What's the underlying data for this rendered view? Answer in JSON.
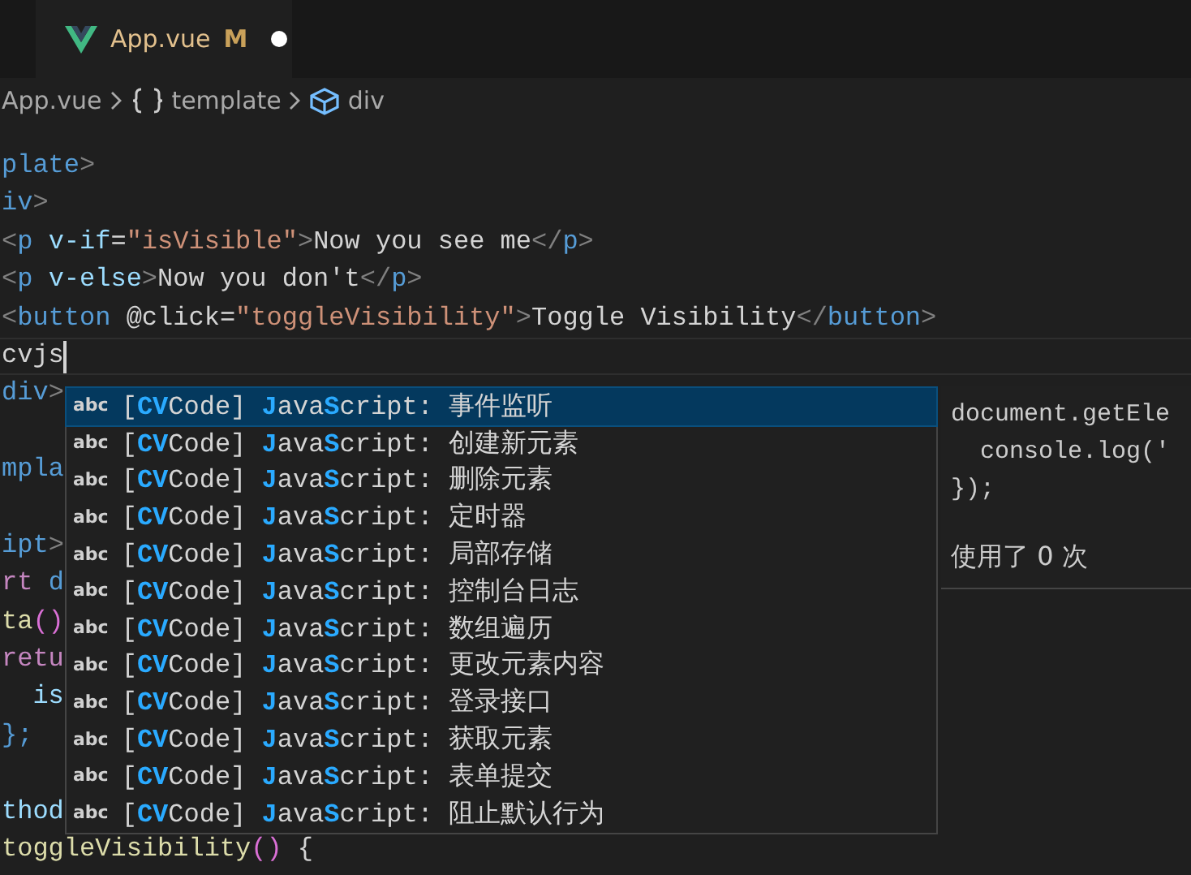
{
  "tab": {
    "title": "App.vue",
    "status": "M",
    "modified": true
  },
  "breadcrumb": [
    {
      "kind": "file",
      "label": "App.vue"
    },
    {
      "kind": "braces",
      "label": "template"
    },
    {
      "kind": "element",
      "label": "div"
    }
  ],
  "code": [
    {
      "current": false,
      "tokens": [
        {
          "text": "plate",
          "kind": "tag"
        },
        {
          "text": ">",
          "kind": "punct"
        }
      ]
    },
    {
      "current": false,
      "tokens": [
        {
          "text": "iv",
          "kind": "tag"
        },
        {
          "text": ">",
          "kind": "punct"
        }
      ]
    },
    {
      "current": false,
      "tokens": [
        {
          "text": "<",
          "kind": "punct"
        },
        {
          "text": "p ",
          "kind": "tag"
        },
        {
          "text": "v-if",
          "kind": "attr"
        },
        {
          "text": "=",
          "kind": "text"
        },
        {
          "text": "\"isVisible\"",
          "kind": "string"
        },
        {
          "text": ">",
          "kind": "punct"
        },
        {
          "text": "Now you see me",
          "kind": "text"
        },
        {
          "text": "</",
          "kind": "punct"
        },
        {
          "text": "p",
          "kind": "tag"
        },
        {
          "text": ">",
          "kind": "punct"
        }
      ]
    },
    {
      "current": false,
      "tokens": [
        {
          "text": "<",
          "kind": "punct"
        },
        {
          "text": "p ",
          "kind": "tag"
        },
        {
          "text": "v-else",
          "kind": "attr"
        },
        {
          "text": ">",
          "kind": "punct"
        },
        {
          "text": "Now you don't",
          "kind": "text"
        },
        {
          "text": "</",
          "kind": "punct"
        },
        {
          "text": "p",
          "kind": "tag"
        },
        {
          "text": ">",
          "kind": "punct"
        }
      ]
    },
    {
      "current": false,
      "tokens": [
        {
          "text": "<",
          "kind": "punct"
        },
        {
          "text": "button ",
          "kind": "tag"
        },
        {
          "text": "@click",
          "kind": "text"
        },
        {
          "text": "=",
          "kind": "text"
        },
        {
          "text": "\"toggleVisibility\"",
          "kind": "string"
        },
        {
          "text": ">",
          "kind": "punct"
        },
        {
          "text": "Toggle Visibility",
          "kind": "text"
        },
        {
          "text": "</",
          "kind": "punct"
        },
        {
          "text": "button",
          "kind": "tag"
        },
        {
          "text": ">",
          "kind": "punct"
        }
      ]
    },
    {
      "current": true,
      "tokens": [
        {
          "text": "cvjs",
          "kind": "text"
        }
      ]
    },
    {
      "current": false,
      "tokens": [
        {
          "text": "div",
          "kind": "tag"
        },
        {
          "text": ">",
          "kind": "punct"
        }
      ]
    },
    {
      "current": false
    },
    {
      "current": false,
      "tokens": [
        {
          "text": "mpla",
          "kind": "tag"
        }
      ]
    },
    {
      "current": false
    },
    {
      "current": false,
      "tokens": [
        {
          "text": "ipt",
          "kind": "tag"
        },
        {
          "text": ">",
          "kind": "punct"
        }
      ]
    },
    {
      "current": false,
      "tokens": [
        {
          "text": "rt ",
          "kind": "keyword"
        },
        {
          "text": "d",
          "kind": "tag"
        }
      ]
    },
    {
      "current": false,
      "tokens": [
        {
          "text": "ta",
          "kind": "func"
        },
        {
          "text": "()",
          "kind": "bracket"
        }
      ]
    },
    {
      "current": false,
      "tokens": [
        {
          "text": "retu",
          "kind": "keyword"
        }
      ]
    },
    {
      "current": false,
      "tokens": [
        {
          "text": "  is",
          "kind": "attr"
        }
      ]
    },
    {
      "current": false,
      "tokens": [
        {
          "text": "};",
          "kind": "brace"
        }
      ]
    },
    {
      "current": false
    },
    {
      "current": false,
      "tokens": [
        {
          "text": "thod",
          "kind": "attr"
        }
      ]
    },
    {
      "current": false,
      "tokens": [
        {
          "text": "toggleVisibility",
          "kind": "func"
        },
        {
          "text": "()",
          "kind": "bracket"
        },
        {
          "text": " {",
          "kind": "text"
        }
      ]
    }
  ],
  "suggestions": [
    {
      "icon_text": "abc",
      "label": "[**CV**Code] **J**ava**S**cript: 事件监听",
      "selected": true
    },
    {
      "icon_text": "abc",
      "label": "[**CV**Code] **J**ava**S**cript: 创建新元素",
      "selected": false
    },
    {
      "icon_text": "abc",
      "label": "[**CV**Code] **J**ava**S**cript: 删除元素",
      "selected": false
    },
    {
      "icon_text": "abc",
      "label": "[**CV**Code] **J**ava**S**cript: 定时器",
      "selected": false
    },
    {
      "icon_text": "abc",
      "label": "[**CV**Code] **J**ava**S**cript: 局部存储",
      "selected": false
    },
    {
      "icon_text": "abc",
      "label": "[**CV**Code] **J**ava**S**cript: 控制台日志",
      "selected": false
    },
    {
      "icon_text": "abc",
      "label": "[**CV**Code] **J**ava**S**cript: 数组遍历",
      "selected": false
    },
    {
      "icon_text": "abc",
      "label": "[**CV**Code] **J**ava**S**cript: 更改元素内容",
      "selected": false
    },
    {
      "icon_text": "abc",
      "label": "[**CV**Code] **J**ava**S**cript: 登录接口",
      "selected": false
    },
    {
      "icon_text": "abc",
      "label": "[**CV**Code] **J**ava**S**cript: 获取元素",
      "selected": false
    },
    {
      "icon_text": "abc",
      "label": "[**CV**Code] **J**ava**S**cript: 表单提交",
      "selected": false
    },
    {
      "icon_text": "abc",
      "label": "[**CV**Code] **J**ava**S**cript: 阻止默认行为",
      "selected": false
    }
  ],
  "detail": {
    "code": [
      "document.getEle",
      "  console.log('",
      "});"
    ],
    "usage": "使用了 0 次"
  }
}
